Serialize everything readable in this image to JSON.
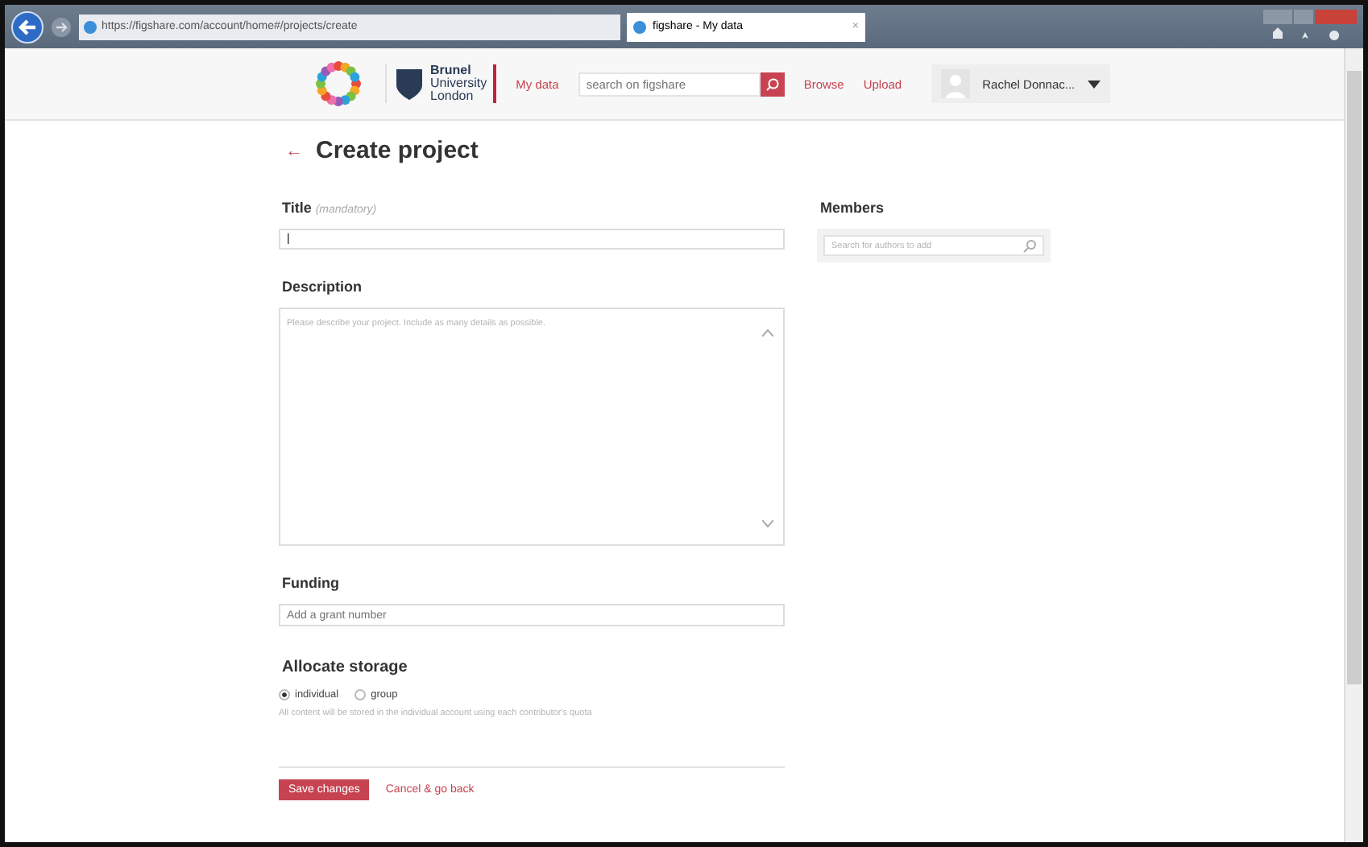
{
  "browser": {
    "url": "https://figshare.com/account/home#/projects/create",
    "tab": "figshare - My data",
    "tab_close": "×"
  },
  "header": {
    "logo_name": "Brunel",
    "logo_sub1": "University",
    "logo_sub2": "London",
    "nav": [
      {
        "label": "My data"
      },
      {
        "label": "Browse"
      },
      {
        "label": "Upload"
      }
    ],
    "search": {
      "placeholder": "search on figshare"
    },
    "user": "Rachel Donnac..."
  },
  "page": {
    "back": "←",
    "title": "Create project",
    "title_field": {
      "label": "Title",
      "hint": "(mandatory)",
      "value": "|"
    },
    "description": {
      "label": "Description",
      "placeholder": "Please describe your project. Include as many details as possible."
    },
    "funding": {
      "label": "Funding",
      "placeholder": "Add a grant number"
    },
    "storage": {
      "label": "Allocate storage",
      "options": [
        {
          "label": "individual",
          "selected": true
        },
        {
          "label": "group",
          "selected": false
        }
      ],
      "note": "All content will be stored in the individual account using each contributor's quota"
    },
    "members": {
      "label": "Members",
      "placeholder": "Search for authors to add"
    },
    "buttons": [
      {
        "label": "Save changes",
        "kind": "primary"
      },
      {
        "label": "Cancel & go back",
        "kind": "link"
      }
    ]
  }
}
